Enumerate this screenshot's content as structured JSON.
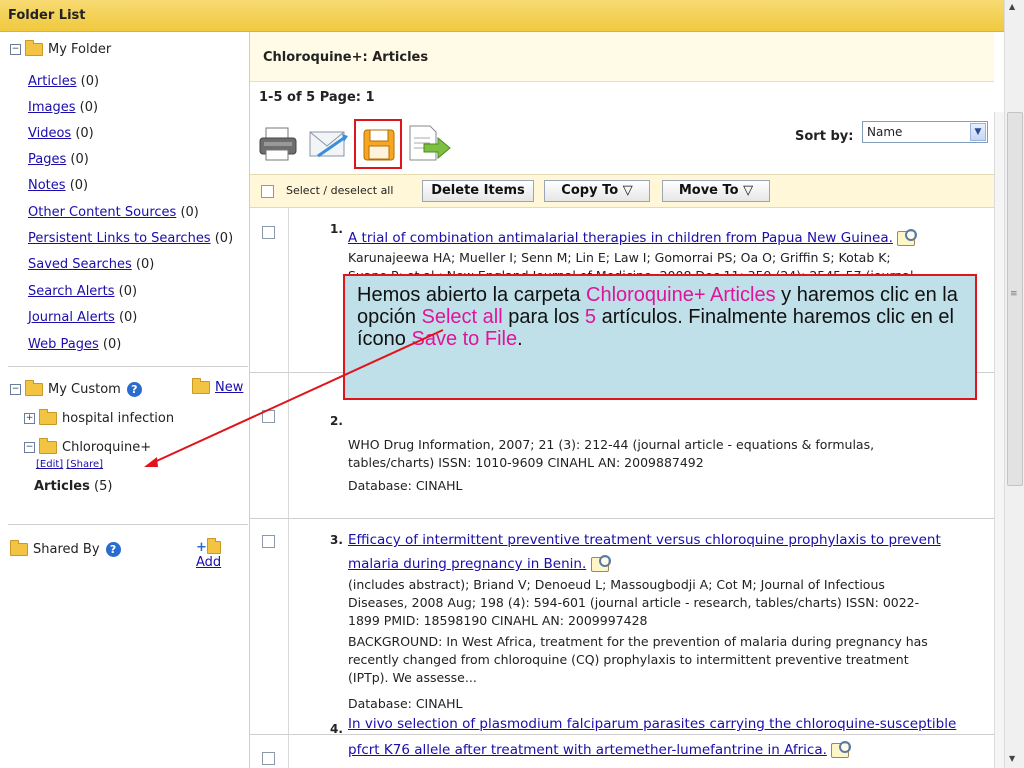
{
  "header": {
    "title": "Folder List"
  },
  "sidebar": {
    "my_folder": {
      "label": "My Folder",
      "items": [
        {
          "label": "Articles",
          "count": "(0)"
        },
        {
          "label": "Images",
          "count": "(0)"
        },
        {
          "label": "Videos",
          "count": "(0)"
        },
        {
          "label": "Pages",
          "count": "(0)"
        },
        {
          "label": "Notes",
          "count": "(0)"
        },
        {
          "label": "Other Content Sources",
          "count": "(0)"
        },
        {
          "label": "Persistent Links to Searches",
          "count": "(0)"
        },
        {
          "label": "Saved Searches",
          "count": "(0)"
        },
        {
          "label": "Search Alerts",
          "count": "(0)"
        },
        {
          "label": "Journal Alerts",
          "count": "(0)"
        },
        {
          "label": "Web Pages",
          "count": "(0)"
        }
      ]
    },
    "my_custom": {
      "label": "My Custom",
      "new_label": "New",
      "folders": [
        {
          "label": "hospital infection"
        },
        {
          "label": "Chloroquine+",
          "edit": "[Edit]",
          "share": "[Share]"
        }
      ],
      "selected": {
        "label": "Articles",
        "count": "(5)"
      }
    },
    "shared_by": {
      "label": "Shared By",
      "add_label": "Add"
    }
  },
  "main": {
    "title": "Chloroquine+:  Articles",
    "paging": "1-5 of 5  Page: 1",
    "sort_label": "Sort by:",
    "sort_value": "Name",
    "select_all": "Select / deselect all",
    "delete": "Delete Items",
    "copy_to": "Copy To",
    "move_to": "Move To"
  },
  "results": [
    {
      "num": "1.",
      "title": "A trial of combination antimalarial therapies in children from Papua New Guinea.",
      "meta": "Karunajeewa HA; Mueller I; Senn M; Lin E; Law I; Gomorrai PS; Oa O; Griffin S; Kotab K;",
      "meta2": "Suano P; et al.; New England Journal of Medicine, 2008 Dec 11; 359 (24): 2545-57 (journal"
    },
    {
      "num": "2.",
      "meta": "WHO Drug Information, 2007; 21 (3): 212-44 (journal article - equations & formulas,",
      "meta2": "tables/charts) ISSN: 1010-9609 CINAHL AN: 2009887492",
      "db": "Database: CINAHL"
    },
    {
      "num": "3.",
      "title": "Efficacy of intermittent preventive treatment versus chloroquine prophylaxis to prevent",
      "title2": "malaria during pregnancy in Benin.",
      "meta": "(includes abstract); Briand V; Denoeud L; Massougbodji A; Cot M; Journal of Infectious",
      "meta2": "Diseases, 2008 Aug; 198 (4): 594-601 (journal article - research, tables/charts) ISSN: 0022-",
      "meta3": "1899 PMID: 18598190 CINAHL AN: 2009997428",
      "abs1": "BACKGROUND: In West Africa, treatment for the prevention of malaria during pregnancy has",
      "abs2": "recently changed from chloroquine (CQ) prophylaxis to intermittent preventive treatment",
      "abs3": "(IPTp). We assesse...",
      "db": "Database: CINAHL"
    },
    {
      "num": "4.",
      "title": "In vivo selection of plasmodium falciparum parasites carrying the chloroquine-susceptible",
      "title2": "pfcrt K76 allele after treatment with artemether-lumefantrine in Africa."
    }
  ],
  "callout": {
    "p1": "Hemos abierto la carpeta ",
    "h1": "Chloroquine+ Articles",
    "p2": " y haremos clic en la opción ",
    "h2": "Select all",
    "p3": " para los ",
    "h3": "5",
    "p4": " artículos.  Finalmente haremos clic en el ícono ",
    "h4": "Save to File",
    "p5": "."
  },
  "colors": {
    "accent": "#f0c93e",
    "highlight": "#e0149a",
    "callout_bg": "#bfe0e8",
    "callout_border": "#e0141b"
  }
}
